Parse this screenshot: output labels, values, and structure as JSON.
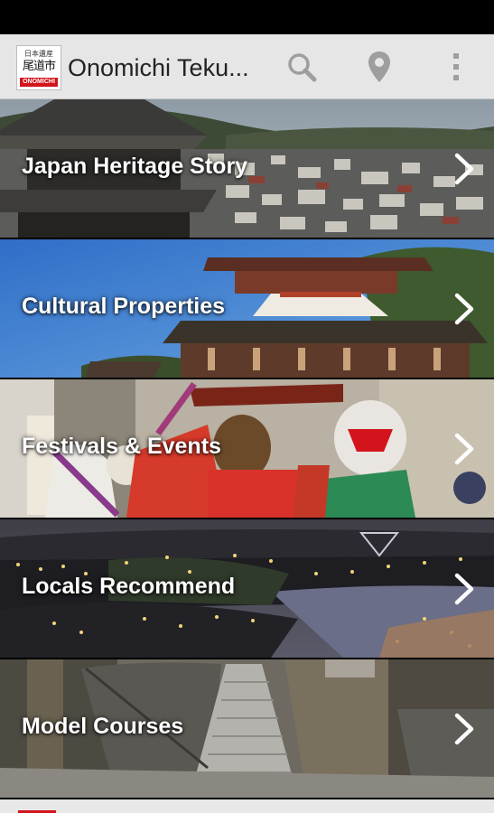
{
  "app": {
    "title": "Onomichi Teku...",
    "logo": {
      "line1": "日本遺産",
      "line2": "尾道市",
      "badge": "ONOMICHI"
    }
  },
  "actions": {
    "search_icon": "search-icon",
    "map_icon": "map-pin-icon",
    "overflow_icon": "overflow-menu-icon"
  },
  "menu": {
    "items": [
      {
        "label": "Japan Heritage Story",
        "icon": "chevron-right-icon"
      },
      {
        "label": "Cultural Properties",
        "icon": "chevron-right-icon"
      },
      {
        "label": "Festivals & Events",
        "icon": "chevron-right-icon"
      },
      {
        "label": "Locals Recommend",
        "icon": "chevron-right-icon"
      },
      {
        "label": "Model Courses",
        "icon": "chevron-right-icon"
      }
    ]
  },
  "colors": {
    "action_bar": "#e6e6e6",
    "brand_red": "#d4141c",
    "icon_gray": "#9e9e9e",
    "label_text": "#ffffff"
  }
}
